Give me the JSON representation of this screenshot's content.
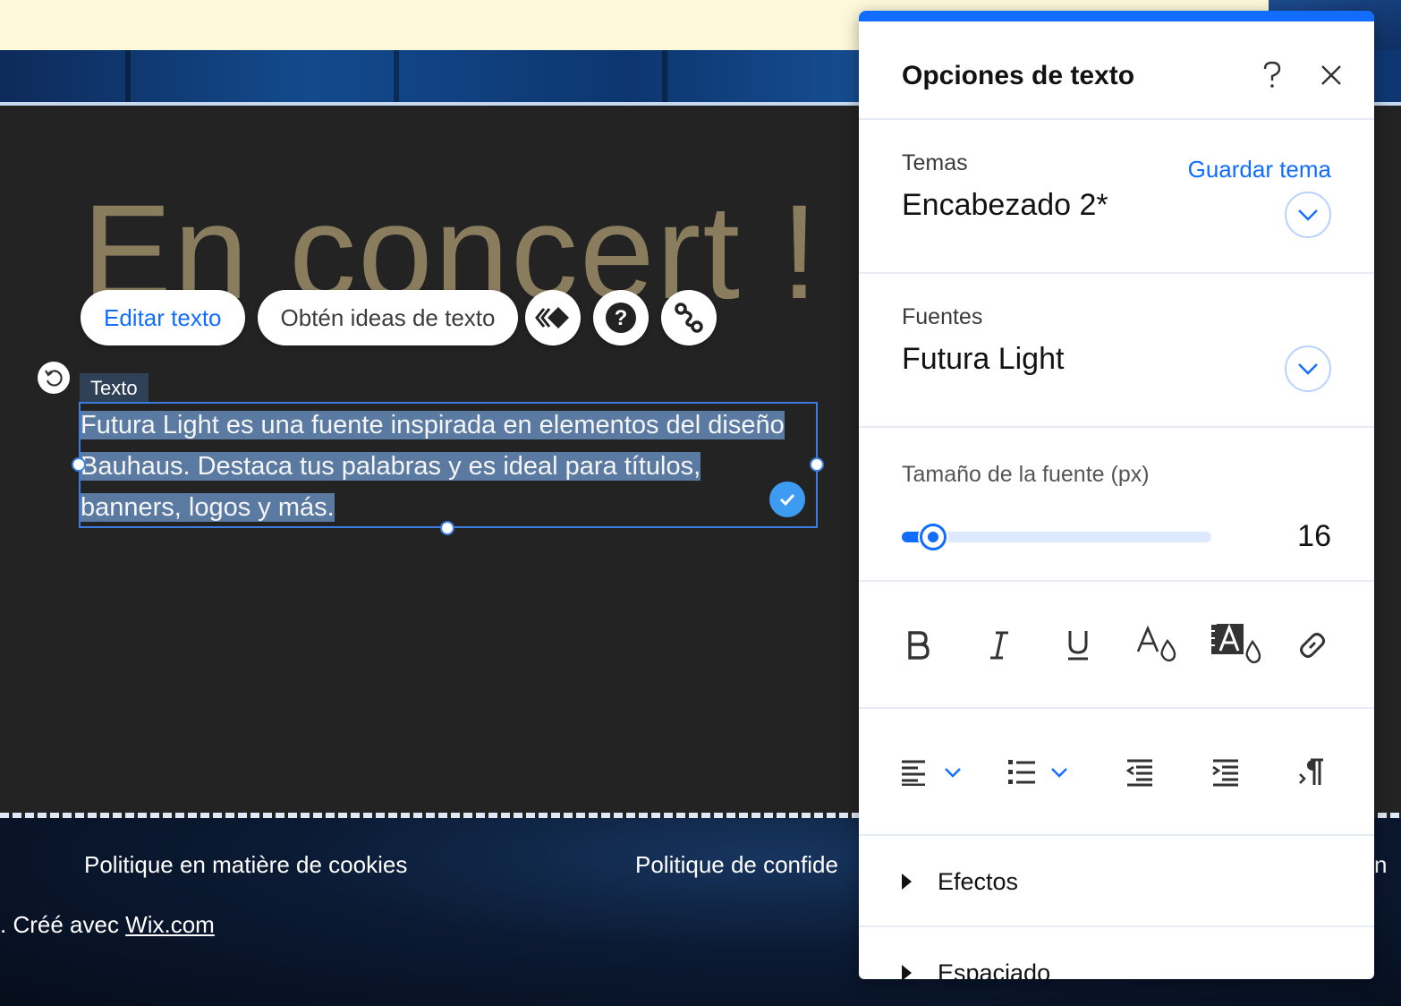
{
  "canvas": {
    "headline": "En concert !",
    "toolbar": {
      "edit_text": "Editar texto",
      "get_ideas": "Obtén ideas de texto"
    },
    "element_tag": "Texto",
    "selected_text_lines": [
      "Futura Light es una fuente inspirada en elementos del diseño",
      "Bauhaus. Destaca tus palabras y es ideal para títulos,",
      "banners, logos y más."
    ],
    "footer": {
      "link_cookies": "Politique en matière de cookies",
      "link_privacy": "Politique de confide",
      "link_right_fragment": "n",
      "credit_prefix": ". Créé avec ",
      "credit_link": "Wix.com"
    }
  },
  "panel": {
    "title": "Opciones de texto",
    "themes": {
      "label": "Temas",
      "save_link": "Guardar tema",
      "value": "Encabezado 2*"
    },
    "fonts": {
      "label": "Fuentes",
      "value": "Futura Light"
    },
    "font_size": {
      "label": "Tamaño de la fuente (px)",
      "value": "16",
      "slider_fraction": 0.1
    },
    "sections": {
      "effects": "Efectos",
      "spacing": "Espaciado"
    },
    "accent_color": "#116dff"
  }
}
